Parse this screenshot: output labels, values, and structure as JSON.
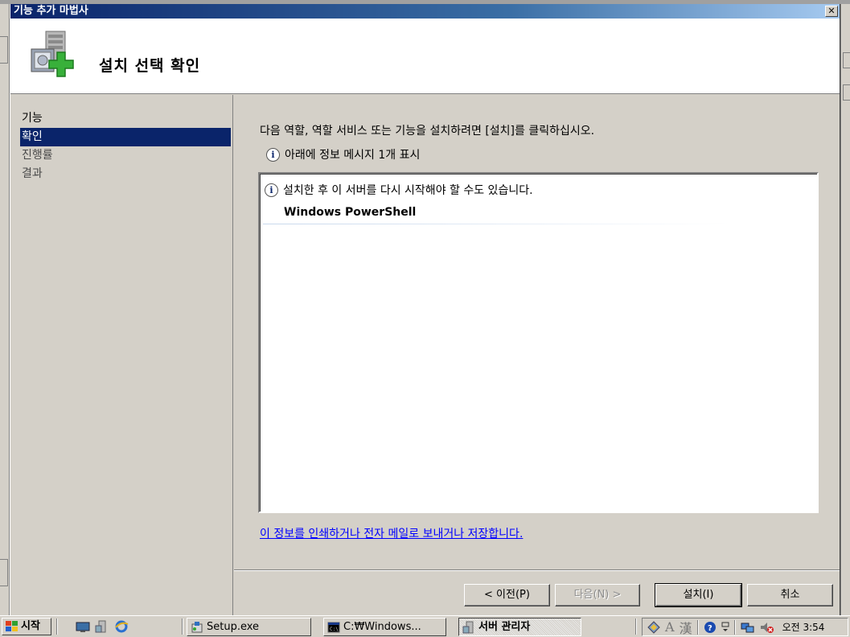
{
  "window": {
    "title": "기능 추가 마법사",
    "close_glyph": "✕"
  },
  "header": {
    "title": "설치 선택 확인",
    "icon": "server-add-feature-icon"
  },
  "sidebar": {
    "items": [
      {
        "label": "기능",
        "active": false
      },
      {
        "label": "확인",
        "active": true
      },
      {
        "label": "진행률",
        "active": false
      },
      {
        "label": "결과",
        "active": false
      }
    ]
  },
  "main": {
    "intro": "다음 역할, 역할 서비스 또는 기능을 설치하려면 [설치]를 클릭하십시오.",
    "info_summary": "아래에 정보 메시지 1개 표시",
    "list": {
      "message": "설치한 후 이 서버를 다시 시작해야 할 수도 있습니다.",
      "feature": "Windows PowerShell"
    },
    "link": "이 정보를 인쇄하거나 전자 메일로 보내거나 저장합니다."
  },
  "buttons": {
    "previous": "< 이전(P)",
    "next": "다음(N) >",
    "install": "설치(I)",
    "cancel": "취소"
  },
  "taskbar": {
    "start": "시작",
    "items": [
      {
        "label": "Setup.exe"
      },
      {
        "label": "C:₩Windows..."
      },
      {
        "label": "서버 관리자"
      }
    ],
    "ime_a": "A",
    "ime_han": "漢",
    "clock": "오전 3:54"
  },
  "colors": {
    "selection": "#0a246a",
    "link": "#0000ff",
    "face": "#d4d0c8"
  }
}
